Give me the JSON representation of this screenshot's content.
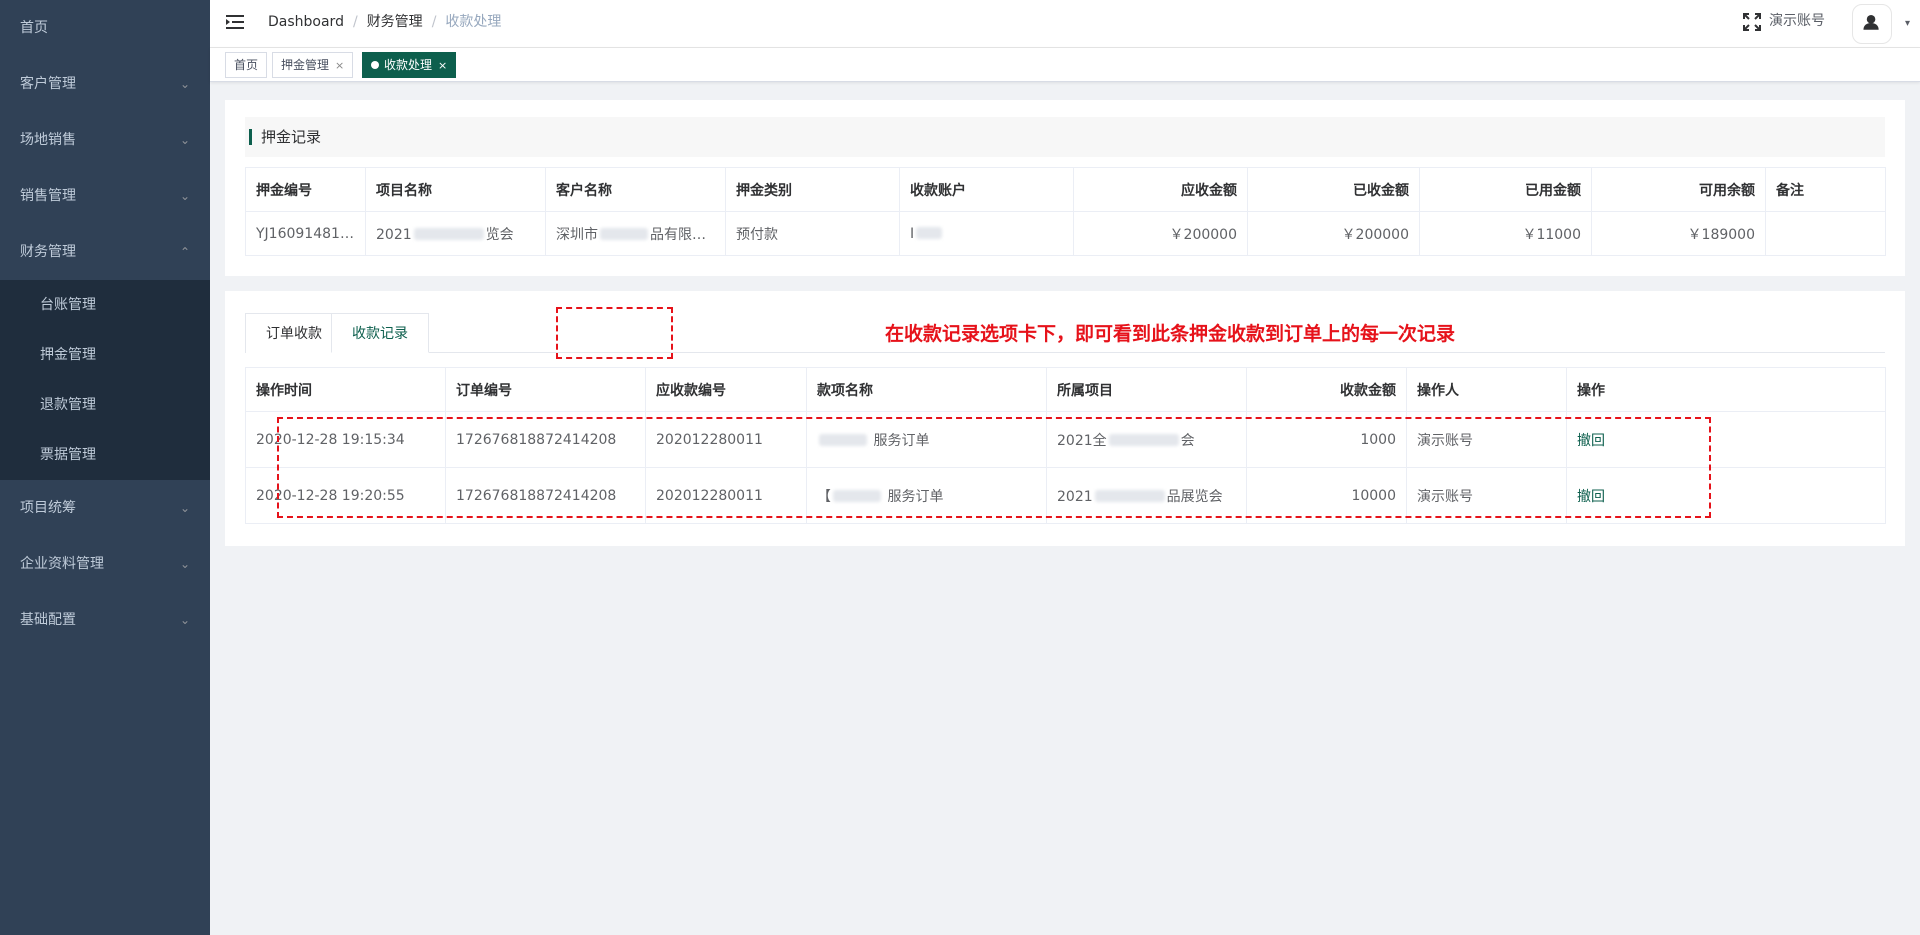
{
  "sidebar": {
    "items": [
      {
        "label": "首页",
        "arrow": ""
      },
      {
        "label": "客户管理",
        "arrow": "⌄"
      },
      {
        "label": "场地销售",
        "arrow": "⌄"
      },
      {
        "label": "销售管理",
        "arrow": "⌄"
      },
      {
        "label": "财务管理",
        "arrow": "⌃"
      }
    ],
    "finance_sub": [
      "台账管理",
      "押金管理",
      "退款管理",
      "票据管理"
    ],
    "items_after": [
      {
        "label": "项目统筹",
        "arrow": "⌄"
      },
      {
        "label": "企业资料管理",
        "arrow": "⌄"
      },
      {
        "label": "基础配置",
        "arrow": "⌄"
      }
    ]
  },
  "navbar": {
    "breadcrumb": [
      "Dashboard",
      "财务管理",
      "收款处理"
    ],
    "separator": "/",
    "user": "演示账号",
    "caret": "▾"
  },
  "tags": [
    {
      "label": "首页",
      "close": ""
    },
    {
      "label": "押金管理",
      "close": "×"
    },
    {
      "label": "收款处理",
      "close": "×"
    }
  ],
  "deposit": {
    "title": "押金记录",
    "headers": [
      "押金编号",
      "项目名称",
      "客户名称",
      "押金类别",
      "收款账户",
      "应收金额",
      "已收金额",
      "已用金额",
      "可用余额",
      "备注"
    ],
    "row": {
      "code": "YJ16091481…",
      "project_pre": "2021",
      "project_post": "览会",
      "customer_pre": "深圳市",
      "customer_post": "品有限公司",
      "category": "预付款",
      "account_pre": "I",
      "receivable": "￥200000",
      "received": "￥200000",
      "used": "￥11000",
      "available": "￥189000",
      "remark": ""
    }
  },
  "tabs": [
    "订单收款",
    "收款记录"
  ],
  "annotation": "在收款记录选项卡下，即可看到此条押金收款到订单上的每一次记录",
  "records": {
    "headers": [
      "操作时间",
      "订单编号",
      "应收款编号",
      "款项名称",
      "所属项目",
      "收款金额",
      "操作人",
      "操作"
    ],
    "rows": [
      {
        "time": "2020-12-28 19:15:34",
        "order": "172676818872414208",
        "receivable": "202012280011",
        "item_pre": "",
        "item_post": "服务订单",
        "project_pre": "2021全",
        "project_post": "会",
        "amount": "1000",
        "operator": "演示账号",
        "action": "撤回"
      },
      {
        "time": "2020-12-28 19:20:55",
        "order": "172676818872414208",
        "receivable": "202012280011",
        "item_pre": "【",
        "item_post": "服务订单",
        "project_pre": "2021",
        "project_post": "品展览会",
        "amount": "10000",
        "operator": "演示账号",
        "action": "撤回"
      }
    ]
  }
}
